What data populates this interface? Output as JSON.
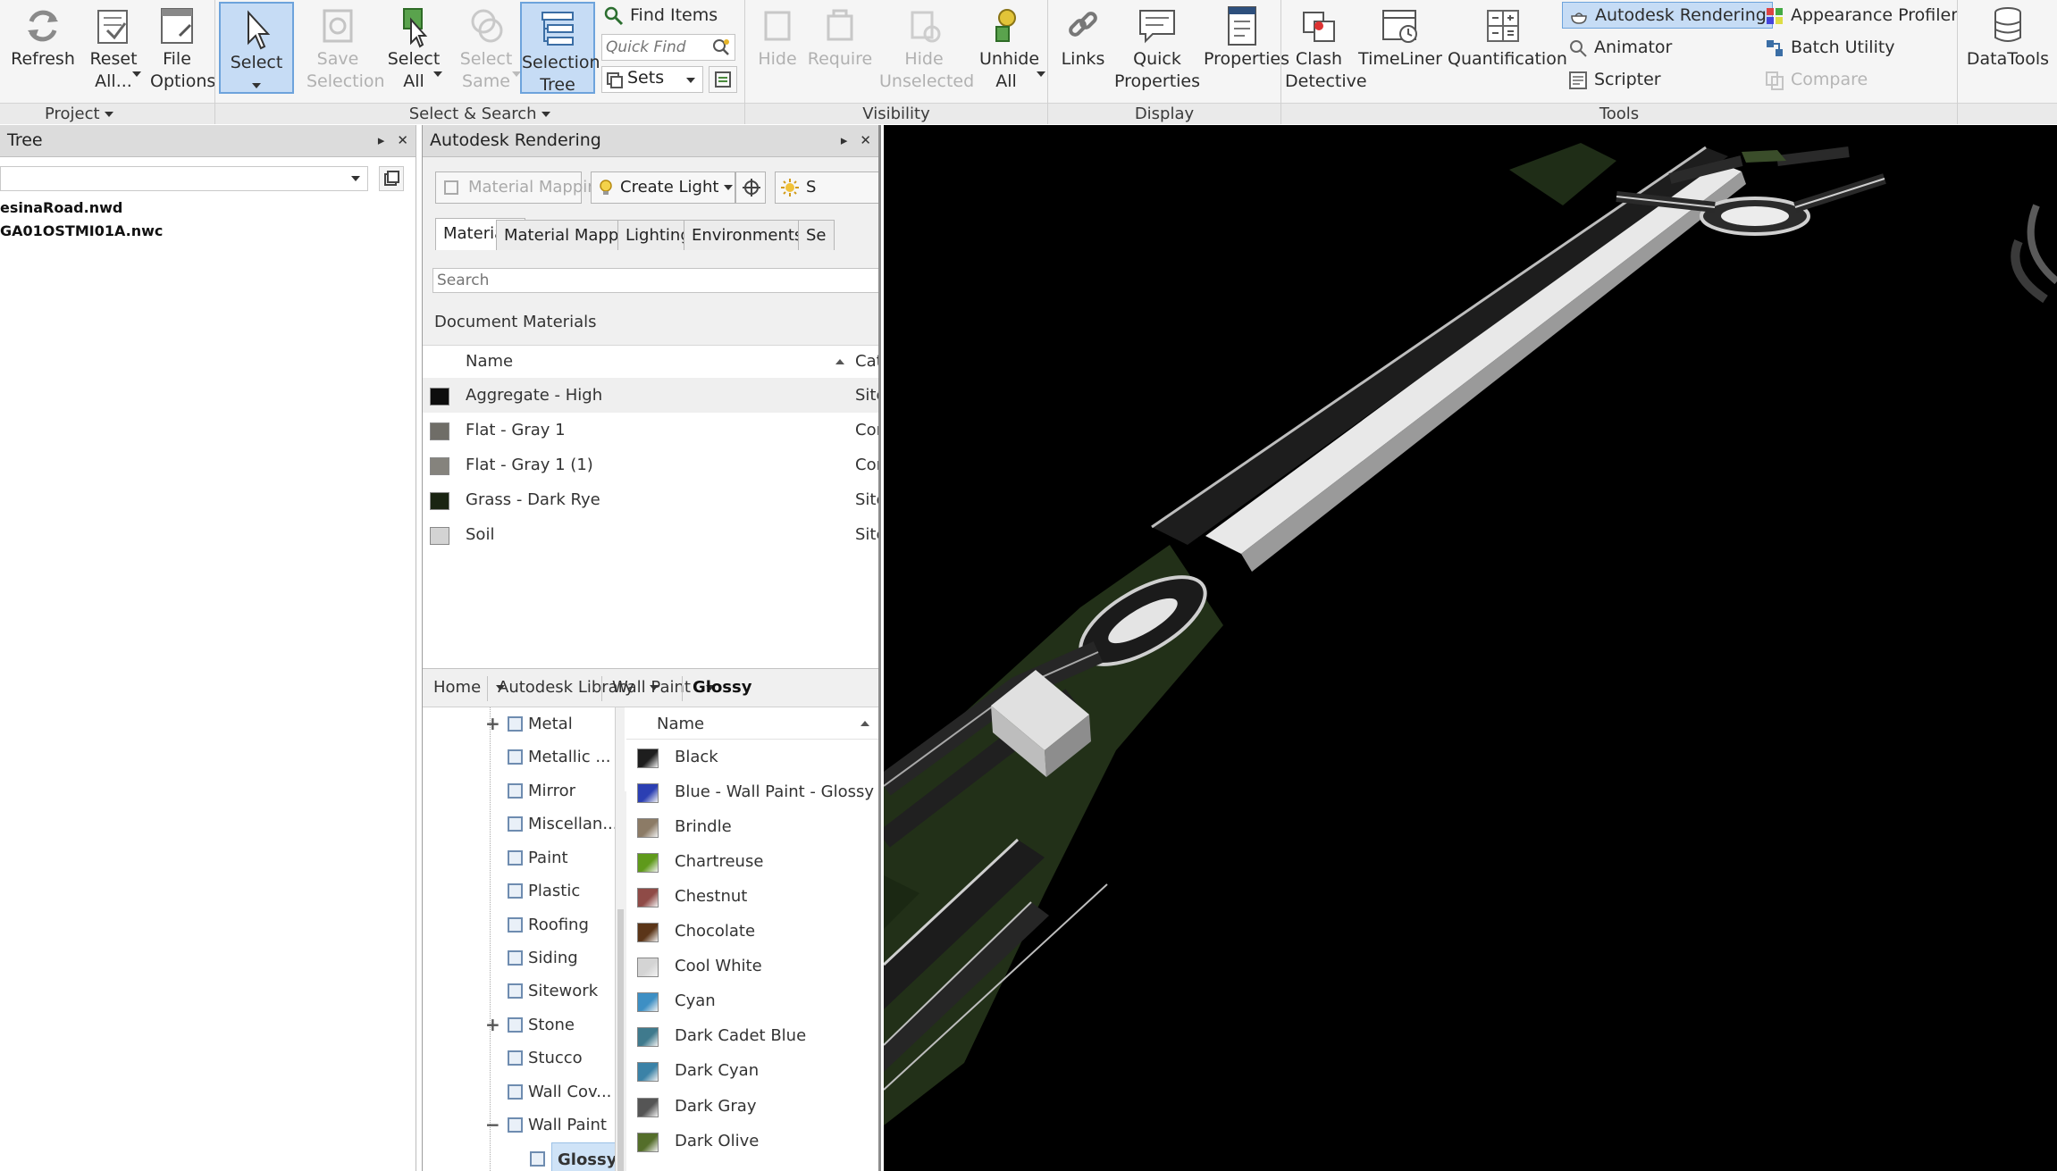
{
  "ribbon": {
    "project": {
      "label": "Project",
      "refresh": "Refresh",
      "reset_all": "Reset All...",
      "file_options": "File Options"
    },
    "select_search": {
      "label": "Select & Search",
      "select": "Select",
      "save_selection": "Save Selection",
      "select_all": "Select All",
      "select_same": "Select Same",
      "selection_tree": "Selection Tree",
      "find_items": "Find Items",
      "quick_find_placeholder": "Quick Find",
      "sets": "Sets"
    },
    "visibility": {
      "label": "Visibility",
      "hide": "Hide",
      "require": "Require",
      "hide_unselected": "Hide Unselected",
      "unhide_all": "Unhide All"
    },
    "display": {
      "label": "Display",
      "links": "Links",
      "quick_properties": "Quick Properties",
      "properties": "Properties"
    },
    "tools": {
      "label": "Tools",
      "clash_detective": "Clash Detective",
      "timeliner": "TimeLiner",
      "quantification": "Quantification",
      "autodesk_rendering": "Autodesk Rendering",
      "animator": "Animator",
      "scripter": "Scripter",
      "appearance_profiler": "Appearance Profiler",
      "batch_utility": "Batch Utility",
      "compare": "Compare",
      "datatools": "DataTools"
    }
  },
  "left_panel": {
    "title": "Tree",
    "files": [
      "esinaRoad.nwd",
      "GA01OSTMI01A.nwc"
    ]
  },
  "render_panel": {
    "title": "Autodesk Rendering",
    "material_mapping_btn": "Material Mapping",
    "create_light_btn": "Create Light",
    "sun_btn": "S",
    "tabs": [
      "Materials",
      "Material Mapping",
      "Lighting",
      "Environments",
      "Se"
    ],
    "search_placeholder": "Search",
    "doc_materials_label": "Document Materials",
    "col_name": "Name",
    "col_category": "Cat",
    "doc_materials": [
      {
        "name": "Aggregate - High",
        "category": "Site",
        "color": "#0d0d0d"
      },
      {
        "name": "Flat - Gray 1",
        "category": "Cor",
        "color": "#6f6d67"
      },
      {
        "name": "Flat - Gray 1 (1)",
        "category": "Cor",
        "color": "#85837d"
      },
      {
        "name": "Grass - Dark Rye",
        "category": "Site",
        "color": "#1a2412"
      },
      {
        "name": "Soil",
        "category": "Site",
        "color": "#d3d3d3"
      }
    ],
    "library_crumbs": {
      "home": "Home",
      "library": "Autodesk Library",
      "wall_paint": "Wall Paint",
      "glossy": "Glossy"
    },
    "library_tree": [
      {
        "label": "Metal",
        "expand": "+"
      },
      {
        "label": "Metallic ...",
        "expand": ""
      },
      {
        "label": "Mirror",
        "expand": ""
      },
      {
        "label": "Miscellan...",
        "expand": ""
      },
      {
        "label": "Paint",
        "expand": ""
      },
      {
        "label": "Plastic",
        "expand": ""
      },
      {
        "label": "Roofing",
        "expand": ""
      },
      {
        "label": "Siding",
        "expand": ""
      },
      {
        "label": "Sitework",
        "expand": ""
      },
      {
        "label": "Stone",
        "expand": "+"
      },
      {
        "label": "Stucco",
        "expand": ""
      },
      {
        "label": "Wall Cov...",
        "expand": ""
      },
      {
        "label": "Wall Paint",
        "expand": "−"
      },
      {
        "label": "Glossy",
        "expand": ""
      }
    ],
    "library_list_header": "Name",
    "library_items": [
      {
        "name": "Black",
        "color": "#1e1e1e"
      },
      {
        "name": "Blue - Wall Paint - Glossy",
        "color": "#2b3fb3"
      },
      {
        "name": "Brindle",
        "color": "#8c7b66"
      },
      {
        "name": "Chartreuse",
        "color": "#5f9a1b"
      },
      {
        "name": "Chestnut",
        "color": "#8f4b47"
      },
      {
        "name": "Chocolate",
        "color": "#5b3518"
      },
      {
        "name": "Cool White",
        "color": "#d4d4d4"
      },
      {
        "name": "Cyan",
        "color": "#3d8fc4"
      },
      {
        "name": "Dark Cadet Blue",
        "color": "#3f7a8d"
      },
      {
        "name": "Dark Cyan",
        "color": "#3b82a7"
      },
      {
        "name": "Dark Gray",
        "color": "#555555"
      },
      {
        "name": "Dark Olive",
        "color": "#546e2a"
      }
    ]
  }
}
